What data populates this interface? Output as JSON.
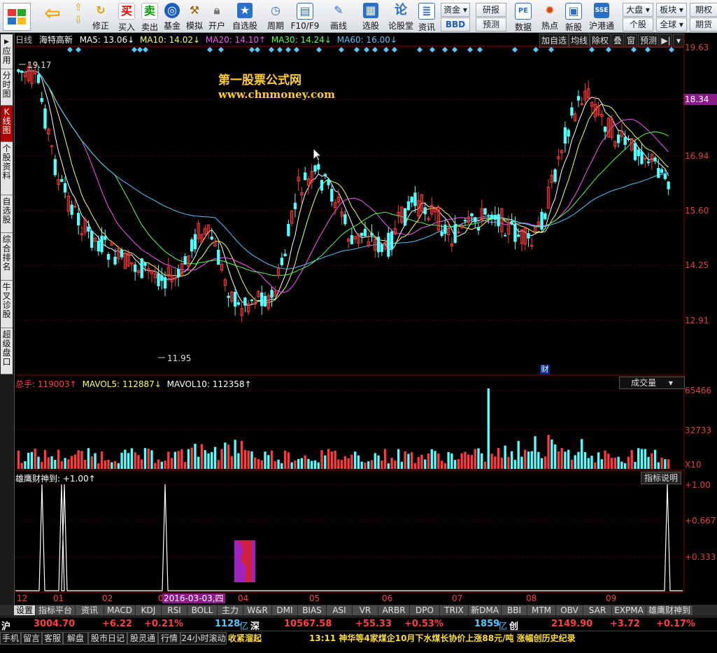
{
  "toolbar": {
    "buttons": [
      {
        "label": "修正",
        "icon": "refresh-icon"
      },
      {
        "label": "买入",
        "icon": "buy-icon"
      },
      {
        "label": "卖出",
        "icon": "sell-icon"
      },
      {
        "label": "基金",
        "icon": "fund-icon"
      },
      {
        "label": "模拟",
        "icon": "simulate-icon"
      },
      {
        "label": "开户",
        "icon": "lock-icon"
      },
      {
        "label": "自选股",
        "icon": "star-icon"
      },
      {
        "label": "周期",
        "icon": "clock-icon"
      },
      {
        "label": "F10/F9",
        "icon": "f10-icon"
      },
      {
        "label": "画线",
        "icon": "pen-icon"
      },
      {
        "label": "选股",
        "icon": "screen-icon"
      },
      {
        "label": "论股堂",
        "icon": "discuss-icon"
      },
      {
        "label": "资讯",
        "icon": "news-icon"
      },
      {
        "label": "数据",
        "icon": "pe-icon"
      },
      {
        "label": "热点",
        "icon": "hot-icon"
      },
      {
        "label": "新股",
        "icon": "newstock-icon"
      },
      {
        "label": "沪港通",
        "icon": "hk-icon"
      }
    ],
    "small": {
      "zijin": "资金",
      "bbd": "BBD",
      "yanbao": "研报",
      "yuce": "预测",
      "dapan": "大盘",
      "gegu": "个股",
      "bankuai": "板块",
      "quanqiu": "全球",
      "qihuo": "期权",
      "qihuo2": "期货"
    },
    "icon_texts": {
      "buy": "买",
      "sell": "卖"
    }
  },
  "sidebar": [
    "应用",
    "分时图",
    "K线图",
    "个股资料",
    "自选股",
    "综合排名",
    "牛叉诊股",
    "超级盘口"
  ],
  "main": {
    "period": "日线",
    "stock": "海特高新",
    "ma5": "MA5: 13.06↓",
    "ma10": "MA10: 14.02↓",
    "ma20": "MA20: 14.10↑",
    "ma30": "MA30: 14.24↓",
    "ma60": "MA60: 16.00↓",
    "buttons": [
      "加自选",
      "均线",
      "除权",
      "叠",
      "窗",
      "预测"
    ],
    "watermark1": "第一股票公式网",
    "watermark2": "www.chnmoney.com",
    "high_label": "19.17",
    "low_label": "11.95",
    "cai": "财",
    "axis": [
      "19.63",
      "18.34",
      "16.94",
      "15.60",
      "14.25",
      "12.91"
    ]
  },
  "volume": {
    "zongshou": "总手: 119003↑",
    "mavol5": "MAVOL5: 112887↓",
    "mavol10": "MAVOL10: 112358↑",
    "selector": "成交量",
    "axis": [
      "65466",
      "32733",
      "X10"
    ]
  },
  "indicator": {
    "title": "雄鹰财神到: +1.00↑",
    "explain": "指标说明",
    "axis": [
      "+1.00",
      "+0.667",
      "+0.333"
    ],
    "months": [
      "12",
      "01",
      "02",
      "03",
      "04",
      "05",
      "06",
      "07",
      "08",
      "09"
    ],
    "cursor_date": "2016-03-03,四"
  },
  "tabs": [
    "设置",
    "指标平台",
    "资讯",
    "MACD",
    "KDJ",
    "RSI",
    "BOLL",
    "主力",
    "W&R",
    "DMI",
    "BIAS",
    "ASI",
    "VR",
    "ARBR",
    "DPO",
    "TRIX",
    "新DMA",
    "BBI",
    "MTM",
    "OBV",
    "SAR",
    "EXPMA",
    "雄鹰财神到"
  ],
  "status": {
    "sh": "沪",
    "sh_index": "3004.70",
    "sh_chg": "+6.22",
    "sh_pct": "+0.21%",
    "sh_amt": "1128",
    "yi1": "亿",
    "sz": "深",
    "sz_index": "10567.58",
    "sz_chg": "+55.33",
    "sz_pct": "+0.53%",
    "sz_amt": "1859",
    "yi2": "亿",
    "cy": "创",
    "cy_index": "2149.90",
    "cy_chg": "+3.72",
    "cy_pct": "+0.17%"
  },
  "status2": {
    "buttons": [
      "手机",
      "留言",
      "客服",
      "解盘",
      "股市日记",
      "股灵通",
      "行情",
      "24小时滚动"
    ],
    "text1": "收紧溜起",
    "news": "13:11 神华等4家煤企10月下水煤长协价上涨88元/吨 涨幅创历史纪录"
  },
  "colors": {
    "up": "#ff3a3a",
    "down": "#54ffff",
    "ma5": "#ffffff",
    "ma10": "#ffff54",
    "ma20": "#ff54ff",
    "ma30": "#54ff54",
    "ma60": "#54c8ff"
  }
}
